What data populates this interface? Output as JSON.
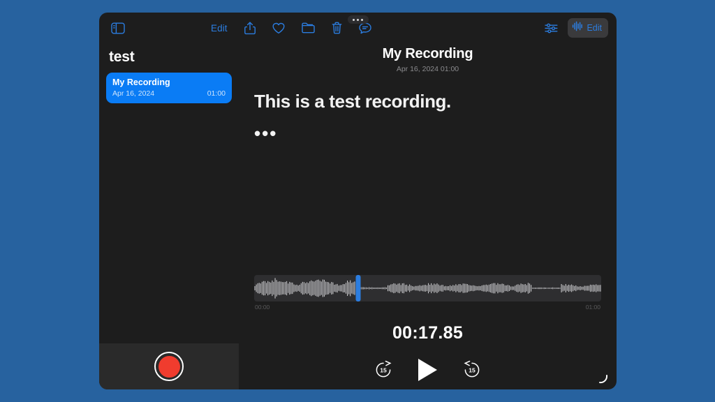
{
  "desktop": {
    "background_color": "#27629f"
  },
  "window": {
    "background_color": "#1d1d1d",
    "multitask_handle_icon": "three-dots-handle-icon"
  },
  "toolbar": {
    "sidebar_toggle_icon": "sidebar-toggle-icon",
    "edit_label": "Edit",
    "share_icon": "share-icon",
    "favorite_icon": "heart-icon",
    "folder_icon": "folder-icon",
    "delete_icon": "trash-icon",
    "transcript_icon": "speech-bubble-text-icon",
    "settings_icon": "sliders-icon",
    "edit_audio_icon": "waveform-icon",
    "edit_audio_label": "Edit",
    "accent_color": "#2b7de0"
  },
  "sidebar": {
    "title": "test",
    "recordings": [
      {
        "name": "My Recording",
        "date": "Apr 16, 2024",
        "duration": "01:00",
        "selected": true
      }
    ],
    "record_button_icon": "record-circle-icon",
    "record_button_color": "#f03c2e",
    "selected_color": "#0a7cf5"
  },
  "detail": {
    "title": "My Recording",
    "subtitle": "Apr 16, 2024  01:00",
    "transcript": "This is a test recording.",
    "transcript_ellipsis": "•••"
  },
  "player": {
    "start_time": "00:00",
    "end_time": "01:00",
    "current_time": "00:17.85",
    "playhead_percent": 30,
    "playhead_color": "#2b7de0",
    "skip_back_icon": "skip-back-15-icon",
    "skip_back_label": "15",
    "play_icon": "play-icon",
    "skip_forward_icon": "skip-forward-15-icon",
    "skip_forward_label": "15"
  },
  "resize_indicator_icon": "resize-arc-icon"
}
